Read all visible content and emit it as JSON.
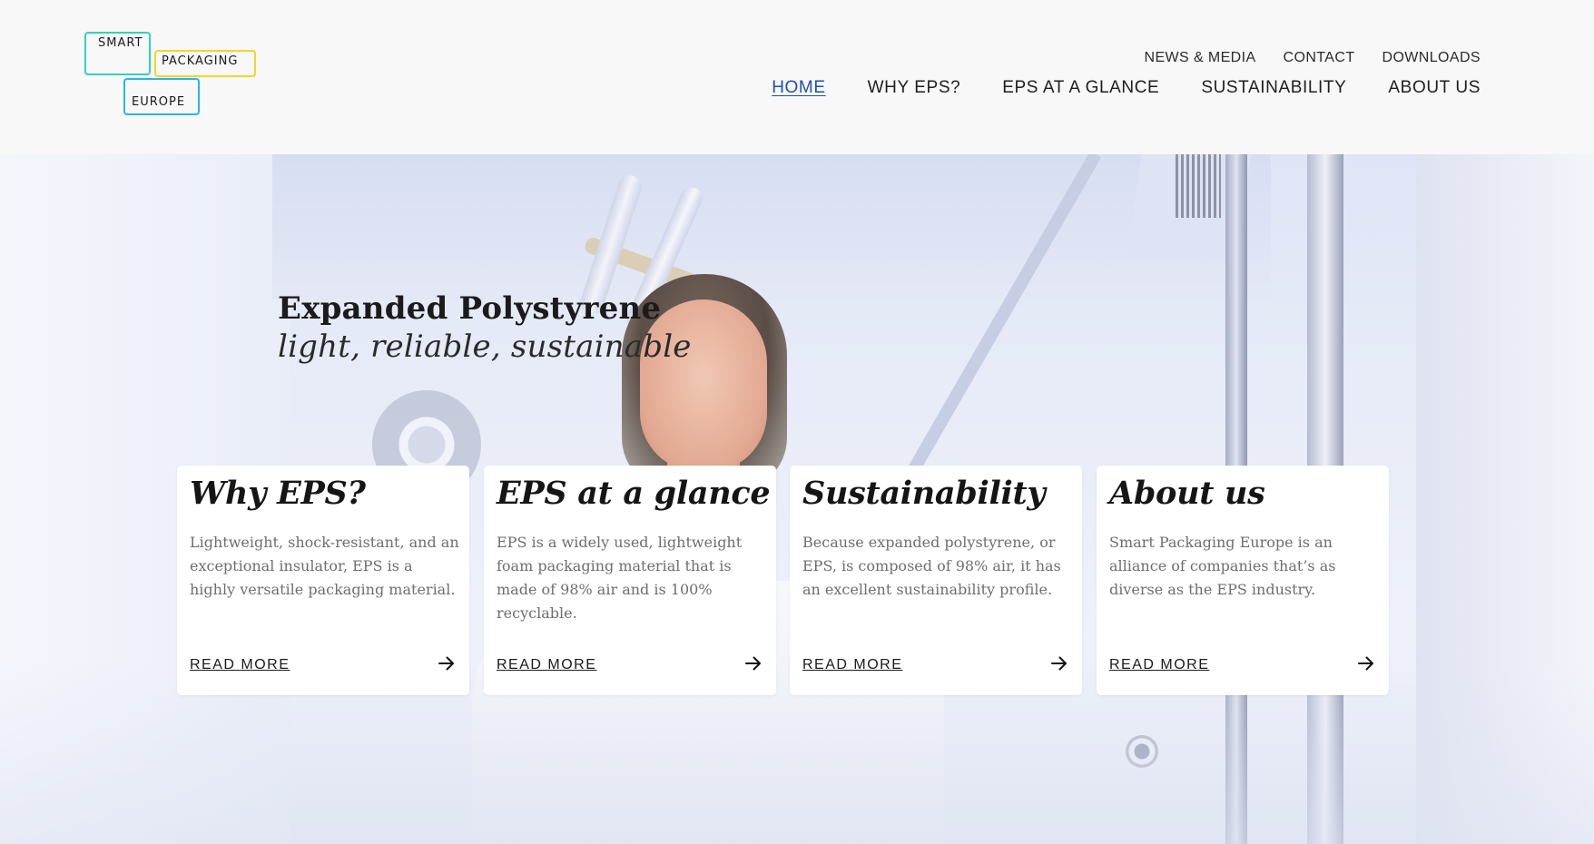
{
  "logo": {
    "line1": "SMART",
    "line2": "PACKAGING",
    "line3": "EUROPE",
    "colors": [
      "#2fd3b5",
      "#f3d52c",
      "#28b6e2"
    ]
  },
  "utility_nav": [
    {
      "label": "NEWS & MEDIA"
    },
    {
      "label": "CONTACT"
    },
    {
      "label": "DOWNLOADS"
    }
  ],
  "main_nav": [
    {
      "label": "HOME",
      "active": true
    },
    {
      "label": "WHY EPS?"
    },
    {
      "label": "EPS AT A GLANCE"
    },
    {
      "label": "SUSTAINABILITY"
    },
    {
      "label": "ABOUT US"
    }
  ],
  "hero": {
    "title": "Expanded Polystyrene",
    "subtitle": "light, reliable, sustainable"
  },
  "cards": [
    {
      "title": "Why EPS?",
      "text": "Lightweight, shock-resistant, and an exceptional insulator, EPS is a highly versatile packaging material.",
      "link": "READ MORE",
      "icon": "arrow-right-icon"
    },
    {
      "title": "EPS at a glance",
      "text": "EPS is a widely used, lightweight foam packaging material that is made of 98% air and is 100% recyclable.",
      "link": "READ MORE",
      "icon": "arrow-right-icon"
    },
    {
      "title": "Sustainability",
      "text": "Because expanded polystyrene, or EPS, is composed of 98% air, it has an excellent sustainability profile.",
      "link": "READ MORE",
      "icon": "arrow-right-icon"
    },
    {
      "title": "About us",
      "text": "Smart Packaging Europe is an alliance of companies that’s as diverse as the EPS industry.",
      "link": "READ MORE",
      "icon": "arrow-right-icon"
    }
  ],
  "colors": {
    "active_link": "#1d4fb0",
    "header_bg": "#f8f8f8",
    "card_bg": "#ffffff"
  }
}
